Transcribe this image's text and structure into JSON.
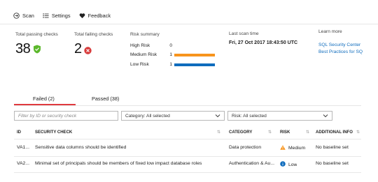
{
  "toolbar": {
    "scan_label": "Scan",
    "settings_label": "Settings",
    "feedback_label": "Feedback"
  },
  "summary": {
    "passing_label": "Total passing checks",
    "passing_value": "38",
    "failing_label": "Total failing checks",
    "failing_value": "2",
    "risk_summary_label": "Risk summary",
    "risks": [
      {
        "name": "High Risk",
        "count": "0",
        "color": "#d13438"
      },
      {
        "name": "Medium Risk",
        "count": "1",
        "color": "#f7941d"
      },
      {
        "name": "Low Risk",
        "count": "1",
        "color": "#0f6cbd"
      }
    ],
    "last_scan_label": "Last scan time",
    "last_scan_value": "Fri, 27 Oct 2017 18:43:50 UTC",
    "learn_more_label": "Learn more",
    "links": [
      "SQL Security Center",
      "Best Practices for SQ"
    ]
  },
  "tabs": [
    {
      "label": "Failed (2)",
      "active": true
    },
    {
      "label": "Passed (38)",
      "active": false
    }
  ],
  "filters": {
    "search_placeholder": "Filter by ID or security check",
    "category_value": "Category: All selected",
    "risk_value": "Risk: All selected"
  },
  "table": {
    "columns": [
      "ID",
      "SECURITY CHECK",
      "CATEGORY",
      "RISK",
      "ADDITIONAL INFO"
    ],
    "rows": [
      {
        "id": "VA1...",
        "check": "Sensitive data columns should be identified",
        "category": "Data protection",
        "risk": "Medium",
        "risk_icon": "warning-icon",
        "info": "No baseline set"
      },
      {
        "id": "VA2...",
        "check": "Minimal set of principals should be members of fixed low impact database roles",
        "category": "Authentication & Au...",
        "risk": "Low",
        "risk_icon": "info-icon",
        "info": "No baseline set"
      }
    ]
  },
  "colors": {
    "accent_red": "#e0393e",
    "pass_green": "#5cb82c",
    "fail_red": "#d83b3b",
    "link_blue": "#0f6cbd",
    "medium_orange": "#f7941d",
    "low_blue": "#0f6cbd"
  }
}
